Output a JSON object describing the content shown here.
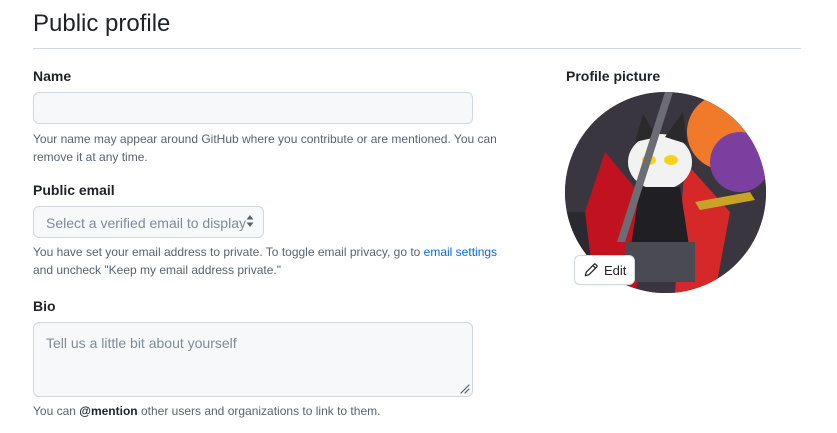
{
  "header": {
    "title": "Public profile"
  },
  "name_field": {
    "label": "Name",
    "value": "",
    "note": "Your name may appear around GitHub where you contribute or are mentioned. You can remove it at any time."
  },
  "email_field": {
    "label": "Public email",
    "selected": "Select a verified email to display",
    "note_before": "You have set your email address to private. To toggle email privacy, go to ",
    "note_link": "email settings",
    "note_after": " and uncheck \"Keep my email address private.\""
  },
  "bio_field": {
    "label": "Bio",
    "placeholder": "Tell us a little bit about yourself",
    "note_before": "You can ",
    "note_mention": "@mention",
    "note_after": " other users and organizations to link to them."
  },
  "profile_picture": {
    "label": "Profile picture",
    "edit_label": "Edit"
  },
  "colors": {
    "accent_link": "#0969da",
    "border": "#d0d7de",
    "muted_text": "#59636e",
    "input_bg": "#f6f8fa"
  }
}
